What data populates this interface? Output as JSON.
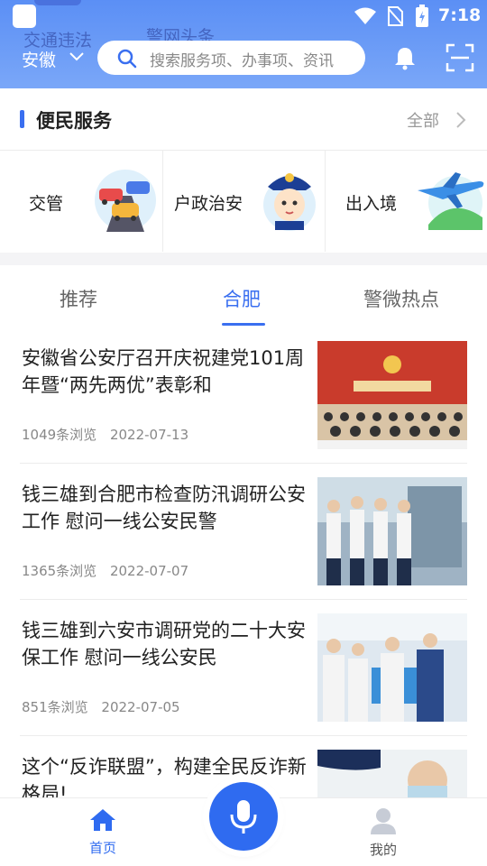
{
  "status_bar": {
    "time": "7:18"
  },
  "header": {
    "ghost_items": [
      "交通违法",
      "警网头条"
    ],
    "province": "安徽",
    "search_placeholder": "搜索服务项、办事项、资讯",
    "icons": [
      "chevron-down-icon",
      "search-icon",
      "bell-icon",
      "scan-icon"
    ]
  },
  "services": {
    "title": "便民服务",
    "all_label": "全部",
    "items": [
      {
        "label": "交管",
        "icon": "cars-icon"
      },
      {
        "label": "户政治安",
        "icon": "police-avatar-icon"
      },
      {
        "label": "出入境",
        "icon": "airplane-icon"
      }
    ]
  },
  "tabs": [
    {
      "label": "推荐",
      "active": false
    },
    {
      "label": "合肥",
      "active": true
    },
    {
      "label": "警微热点",
      "active": false
    }
  ],
  "news": [
    {
      "title": "安徽省公安厅召开庆祝建党101周年暨“两先两优”表彰和",
      "views": "1049条浏览",
      "date": "2022-07-13"
    },
    {
      "title": "钱三雄到合肥市检查防汛调研公安工作 慰问一线公安民警",
      "views": "1365条浏览",
      "date": "2022-07-07"
    },
    {
      "title": "钱三雄到六安市调研党的二十大安保工作 慰问一线公安民",
      "views": "851条浏览",
      "date": "2022-07-05"
    },
    {
      "title": "这个“反诈联盟”，构建全民反诈新格局!",
      "views": "",
      "date": ""
    }
  ],
  "bottom_nav": {
    "home_label": "首页",
    "mine_label": "我的",
    "colors": {
      "active": "#2f6bf0",
      "inactive": "#555555"
    }
  },
  "colors": {
    "accent": "#3a6ff0",
    "header": "#6a9cf7"
  }
}
